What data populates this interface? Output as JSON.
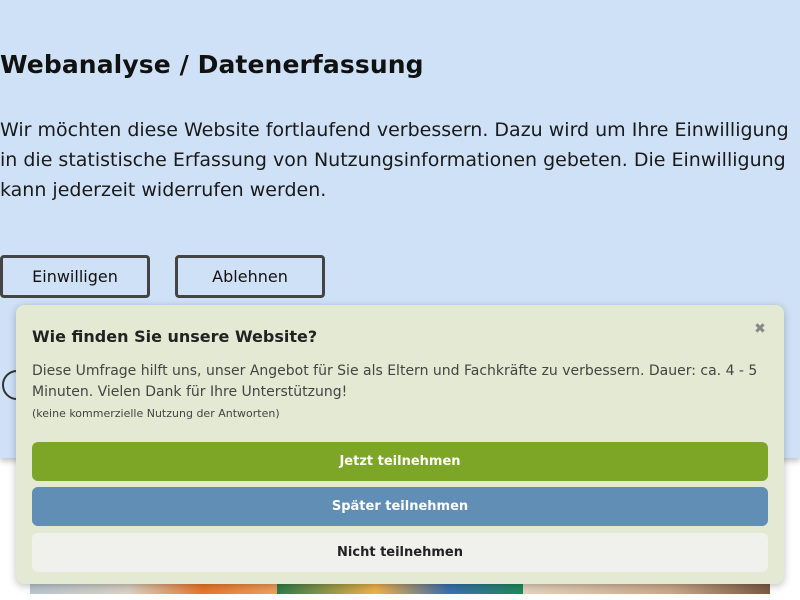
{
  "consent": {
    "title": "Webanalyse / Datenerfassung",
    "text": "Wir möchten diese Website fortlaufend verbessern. Dazu wird um Ihre Einwilligung in die statistische Erfassung von Nutzungsinformationen gebeten. Die Einwilligung kann jederzeit widerrufen werden.",
    "accept_label": "Einwilligen",
    "decline_label": "Ablehnen"
  },
  "survey": {
    "title": "Wie finden Sie unsere Website?",
    "close_icon": "close-icon",
    "close_glyph": "✖",
    "text": "Diese Umfrage hilft uns, unser Angebot für Sie als Eltern und Fachkräfte zu verbessern. Dauer: ca. 4 - 5 Minuten. Vielen Dank für Ihre Unterstützung!",
    "note": "(keine kommerzielle Nutzung der Antworten)",
    "join_label": "Jetzt teilnehmen",
    "later_label": "Später teilnehmen",
    "never_label": "Nicht teilnehmen"
  },
  "colors": {
    "consent_bg": "#cfe1f6",
    "survey_bg": "#e3e9d2",
    "join_button": "#7ea626",
    "later_button": "#608eb5",
    "never_button": "#f0f0ed"
  }
}
